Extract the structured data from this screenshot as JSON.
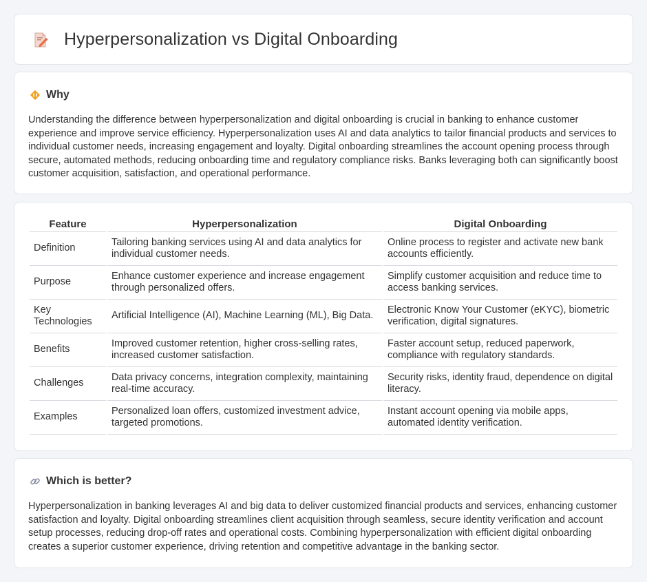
{
  "page": {
    "title": "Hyperpersonalization vs Digital Onboarding"
  },
  "why": {
    "heading": "Why",
    "body": "Understanding the difference between hyperpersonalization and digital onboarding is crucial in banking to enhance customer experience and improve service efficiency. Hyperpersonalization uses AI and data analytics to tailor financial products and services to individual customer needs, increasing engagement and loyalty. Digital onboarding streamlines the account opening process through secure, automated methods, reducing onboarding time and regulatory compliance risks. Banks leveraging both can significantly boost customer acquisition, satisfaction, and operational performance."
  },
  "comparison": {
    "headers": [
      "Feature",
      "Hyperpersonalization",
      "Digital Onboarding"
    ],
    "rows": [
      [
        "Definition",
        "Tailoring banking services using AI and data analytics for individual customer needs.",
        "Online process to register and activate new bank accounts efficiently."
      ],
      [
        "Purpose",
        "Enhance customer experience and increase engagement through personalized offers.",
        "Simplify customer acquisition and reduce time to access banking services."
      ],
      [
        "Key Technologies",
        "Artificial Intelligence (AI), Machine Learning (ML), Big Data.",
        "Electronic Know Your Customer (eKYC), biometric verification, digital signatures."
      ],
      [
        "Benefits",
        "Improved customer retention, higher cross-selling rates, increased customer satisfaction.",
        "Faster account setup, reduced paperwork, compliance with regulatory standards."
      ],
      [
        "Challenges",
        "Data privacy concerns, integration complexity, maintaining real-time accuracy.",
        "Security risks, identity fraud, dependence on digital literacy."
      ],
      [
        "Examples",
        "Personalized loan offers, customized investment advice, targeted promotions.",
        "Instant account opening via mobile apps, automated identity verification."
      ]
    ]
  },
  "better": {
    "heading": "Which is better?",
    "body": "Hyperpersonalization in banking leverages AI and big data to deliver customized financial products and services, enhancing customer satisfaction and loyalty. Digital onboarding streamlines client acquisition through seamless, secure identity verification and account setup processes, reducing drop-off rates and operational costs. Combining hyperpersonalization with efficient digital onboarding creates a superior customer experience, driving retention and competitive advantage in the banking sector."
  },
  "icons": {
    "header": "document-pencil-icon",
    "why": "diamond-warning-icon",
    "better": "link-icon"
  },
  "colors": {
    "background": "#f4f5f9",
    "card": "#ffffff",
    "border": "#e2e4ea",
    "text": "#333333",
    "icon_accent": "#e8734a",
    "why_icon": "#f0a020"
  }
}
